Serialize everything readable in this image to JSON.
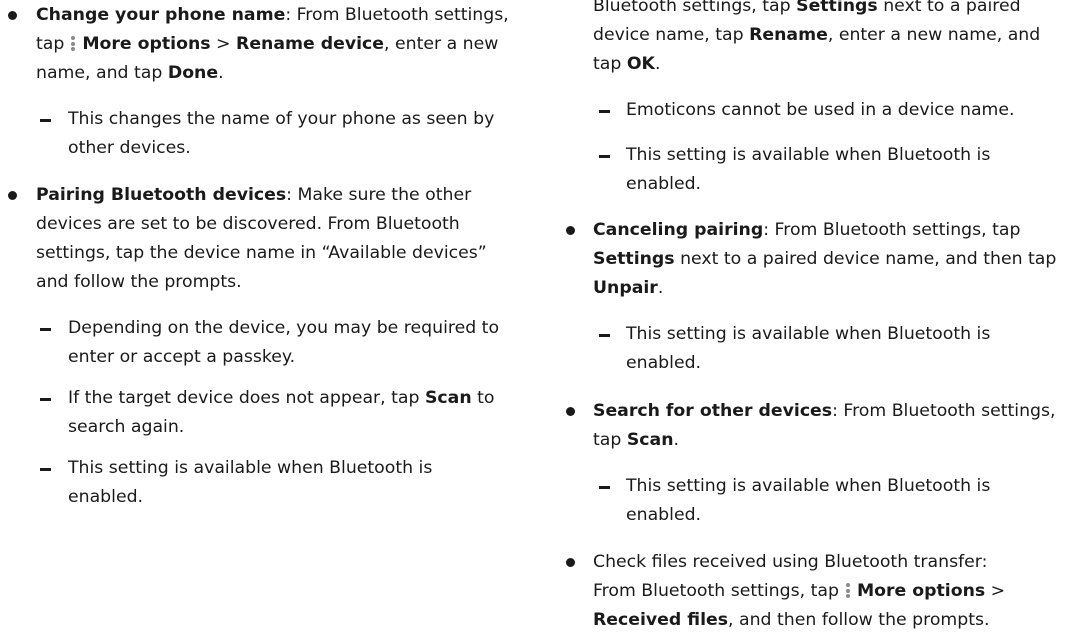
{
  "left": {
    "b1": {
      "title": "Change your phone name",
      "s1": ": From Bluetooth settings,",
      "s2": "tap",
      "more": "More options",
      "sep": " > ",
      "rename": "Rename device",
      "s3": ", enter a new",
      "s4": "name, and tap ",
      "done": "Done",
      "s5": ".",
      "sub1_l1": "This changes the name of your phone as seen by",
      "sub1_l2": "other devices."
    },
    "b2": {
      "title": "Pairing Bluetooth devices",
      "s1": ": Make sure the other",
      "l2": "devices are set to be discovered. From Bluetooth",
      "l3": "settings, tap the device name in “Available devices”",
      "l4": "and follow the prompts.",
      "sub1_l1": "Depending on the device, you may be required to",
      "sub1_l2": "enter or accept a passkey.",
      "sub2_a": "If the target device does not appear, tap ",
      "sub2_scan": "Scan",
      "sub2_b": " to",
      "sub2_l2": "search again.",
      "sub3_l1": "This setting is available when Bluetooth is",
      "sub3_l2": "enabled."
    }
  },
  "right": {
    "cont": {
      "l1a": "Bluetooth settings, tap ",
      "l1b": "Settings",
      "l1c": " next to a paired",
      "l2a": "device name, tap ",
      "l2b": "Rename",
      "l2c": ", enter a new name, and",
      "l3a": "tap ",
      "l3b": "OK",
      "l3c": ".",
      "sub1": "Emoticons cannot be used in a device name.",
      "sub2_l1": "This setting is available when Bluetooth is",
      "sub2_l2": "enabled."
    },
    "b3": {
      "title": "Canceling pairing",
      "s1": ": From Bluetooth settings, tap",
      "l2a": "Settings",
      "l2b": " next to a paired device name, and then tap",
      "l3a": "Unpair",
      "l3b": ".",
      "sub1_l1": "This setting is available when Bluetooth is",
      "sub1_l2": "enabled."
    },
    "b4": {
      "title": "Search for other devices",
      "s1": ": From Bluetooth settings,",
      "l2a": "tap ",
      "l2b": "Scan",
      "l2c": ".",
      "sub1_l1": "This setting is available when Bluetooth is",
      "sub1_l2": "enabled."
    },
    "b5": {
      "l1": "Check files received using Bluetooth transfer:",
      "l2a": "From Bluetooth settings, tap",
      "more": "More options",
      "sep": " >",
      "l3a": "Received files",
      "l3b": ", and then follow the prompts."
    }
  }
}
